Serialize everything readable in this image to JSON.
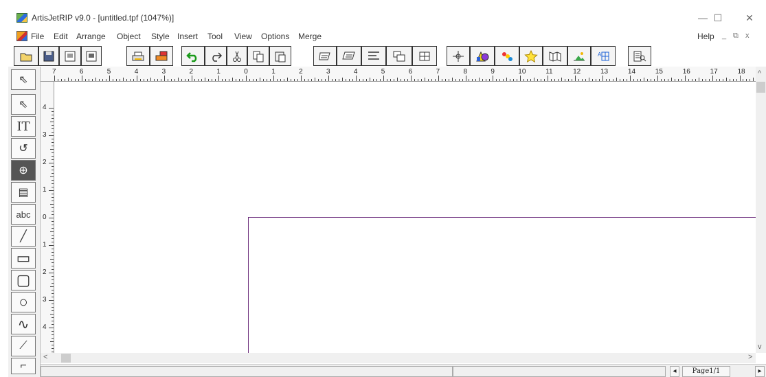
{
  "window": {
    "title": "ArtisJetRIP v9.0 - [untitled.tpf (1047%)]",
    "minimize": "—",
    "maximize": "☐",
    "close": "✕"
  },
  "menu": {
    "items": [
      "File",
      "Edit",
      "Arrange",
      "Object",
      "Style",
      "Insert",
      "Tool",
      "View",
      "Options",
      "Merge"
    ],
    "help": "Help",
    "mdi_controls": [
      "_",
      "⧉",
      "x"
    ]
  },
  "toolbar": {
    "buttons": [
      {
        "name": "open-button",
        "icon": "folder-open-icon"
      },
      {
        "name": "save-button",
        "icon": "floppy-icon"
      },
      {
        "name": "import-button",
        "icon": "import-icon"
      },
      {
        "name": "export-button",
        "icon": "export-icon"
      },
      {
        "name": "print-button",
        "icon": "printer-icon"
      },
      {
        "name": "rip-print-button",
        "icon": "rip-printer-icon"
      },
      {
        "name": "undo-button",
        "icon": "undo-icon"
      },
      {
        "name": "redo-button",
        "icon": "redo-icon"
      },
      {
        "name": "cut-button",
        "icon": "scissors-icon"
      },
      {
        "name": "copy-button",
        "icon": "copy-icon"
      },
      {
        "name": "paste-button",
        "icon": "paste-icon"
      },
      {
        "name": "bring-front-button",
        "icon": "bring-front-icon"
      },
      {
        "name": "send-back-button",
        "icon": "send-back-icon"
      },
      {
        "name": "align-button",
        "icon": "align-icon"
      },
      {
        "name": "group-button",
        "icon": "group-icon"
      },
      {
        "name": "ungroup-button",
        "icon": "ungroup-icon"
      },
      {
        "name": "move-button",
        "icon": "move-cross-icon"
      },
      {
        "name": "shapes-button",
        "icon": "shapes-icon"
      },
      {
        "name": "color-button",
        "icon": "color-icon"
      },
      {
        "name": "star-button",
        "icon": "star-icon"
      },
      {
        "name": "map-button",
        "icon": "map-icon"
      },
      {
        "name": "import-image-button",
        "icon": "image-icon"
      },
      {
        "name": "text-effect-button",
        "icon": "text-effect-icon"
      },
      {
        "name": "preview-button",
        "icon": "preview-icon"
      }
    ]
  },
  "tools": [
    {
      "name": "select-tool",
      "glyph": "⇖"
    },
    {
      "name": "node-select-tool",
      "glyph": "⇖"
    },
    {
      "name": "text-tool",
      "glyph": "IT"
    },
    {
      "name": "rotate-tool",
      "glyph": "↺"
    },
    {
      "name": "zoom-tool",
      "glyph": "⊕"
    },
    {
      "name": "page-tool",
      "glyph": "▤"
    },
    {
      "name": "abc-tool",
      "glyph": "abc"
    },
    {
      "name": "line-tool",
      "glyph": "╱"
    },
    {
      "name": "rectangle-tool",
      "glyph": "▭"
    },
    {
      "name": "rounded-rect-tool",
      "glyph": "▢"
    },
    {
      "name": "ellipse-tool",
      "glyph": "○"
    },
    {
      "name": "curve-tool",
      "glyph": "∿"
    },
    {
      "name": "pen-tool",
      "glyph": "⟋"
    },
    {
      "name": "dimension-tool",
      "glyph": "⌐"
    }
  ],
  "ruler": {
    "top_labels": [
      "7",
      "6",
      "5",
      "4",
      "3",
      "2",
      "1",
      "0",
      "1",
      "2",
      "3",
      "4",
      "5",
      "6",
      "7",
      "8",
      "9",
      "10",
      "11",
      "12",
      "13",
      "14",
      "15",
      "16",
      "17",
      "18"
    ],
    "left_labels": [
      "4",
      "3",
      "2",
      "1",
      "0",
      "1",
      "2",
      "3",
      "4"
    ]
  },
  "status": {
    "page": "Page1/1",
    "prev": "◂",
    "next": "▸"
  }
}
